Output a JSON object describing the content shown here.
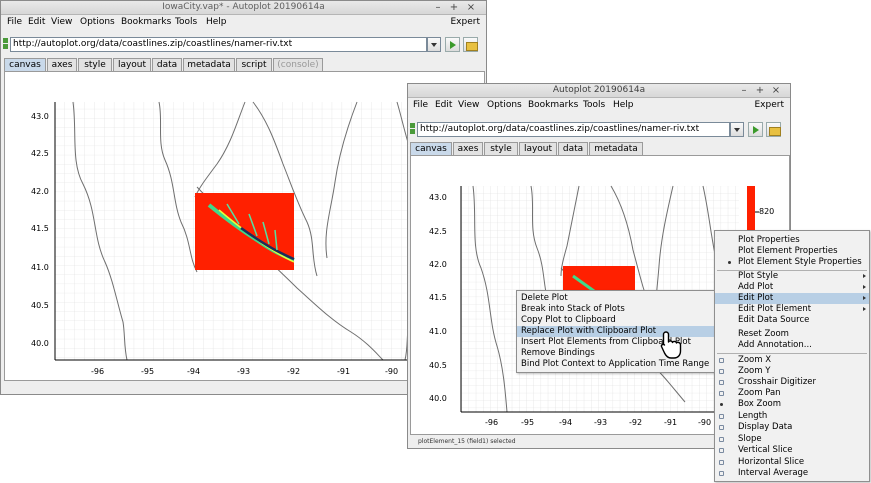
{
  "colors": {
    "accent": "#b8cfe5",
    "heat_red": "#ff2000",
    "coast": "#6f6f6f"
  },
  "back_window": {
    "title": "IowaCity.vap* - Autoplot 20190614a",
    "controls": [
      "–",
      "+",
      "×"
    ],
    "menu": [
      "File",
      "Edit",
      "View",
      "Options",
      "Bookmarks",
      "Tools",
      "Help"
    ],
    "expert_label": "Expert",
    "url": "http://autoplot.org/data/coastlines.zip/coastlines/namer-riv.txt",
    "tabs": [
      "canvas",
      "axes",
      "style",
      "layout",
      "data",
      "metadata",
      "script",
      "(console)"
    ],
    "yticks": [
      "43.0",
      "42.5",
      "42.0",
      "41.5",
      "41.0",
      "40.5",
      "40.0"
    ],
    "xticks": [
      "-96",
      "-95",
      "-94",
      "-93",
      "-92",
      "-91",
      "-90"
    ]
  },
  "front_window": {
    "title": "Autoplot 20190614a",
    "controls": [
      "–",
      "+",
      "×"
    ],
    "menu": [
      "File",
      "Edit",
      "View",
      "Options",
      "Bookmarks",
      "Tools",
      "Help"
    ],
    "expert_label": "Expert",
    "url": "http://autoplot.org/data/coastlines.zip/coastlines/namer-riv.txt",
    "tabs": [
      "canvas",
      "axes",
      "style",
      "layout",
      "data",
      "metadata"
    ],
    "yticks": [
      "43.0",
      "42.5",
      "42.0",
      "41.5",
      "41.0",
      "40.5",
      "40.0"
    ],
    "xticks": [
      "-96",
      "-95",
      "-94",
      "-93",
      "-92",
      "-91",
      "-90"
    ],
    "colorbar_label": "820",
    "status": "plotElement_15 (field1) selected"
  },
  "context_menu": {
    "items": [
      "Delete Plot",
      "Break into Stack of Plots",
      "Copy Plot to Clipboard",
      "Replace Plot with Clipboard Plot",
      "Insert Plot Elements from Clipboard Plot",
      "Remove Bindings",
      "Bind Plot Context to Application Time Range"
    ],
    "highlighted": "Replace Plot with Clipboard Plot"
  },
  "plot_menu": {
    "top": [
      "Plot Properties",
      "Plot Element Properties",
      "Plot Element Style Properties"
    ],
    "mid": [
      "Plot Style",
      "Add Plot",
      "Edit Plot",
      "Edit Plot Element",
      "Edit Data Source",
      "Reset Zoom",
      "Add Annotation..."
    ],
    "submenu_items": [
      "Plot Style",
      "Add Plot",
      "Edit Plot",
      "Edit Plot Element"
    ],
    "highlighted": "Edit Plot",
    "modes": [
      "Zoom X",
      "Zoom Y",
      "Crosshair Digitizer",
      "Zoom Pan",
      "Box Zoom",
      "Length",
      "Display Data",
      "Slope",
      "Vertical Slice",
      "Horizontal Slice",
      "Interval Average"
    ],
    "selected_mode": "Box Zoom"
  }
}
